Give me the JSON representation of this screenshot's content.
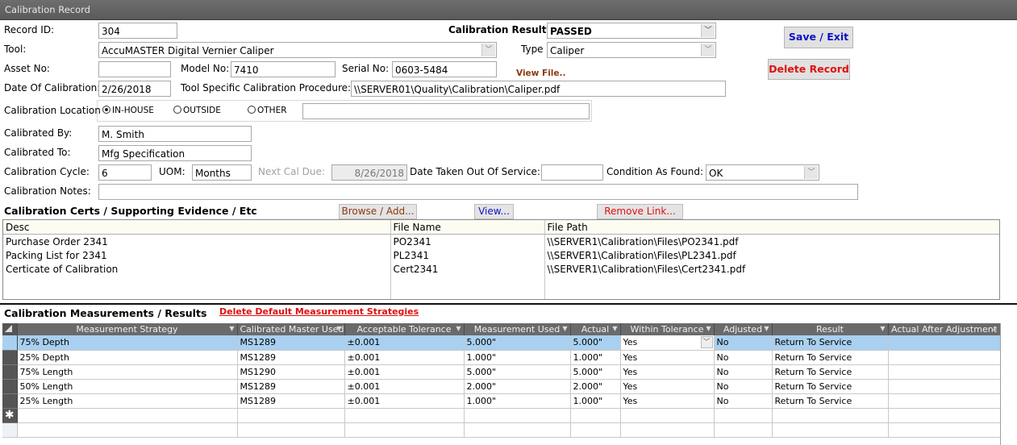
{
  "window": {
    "title": "Calibration Record"
  },
  "record": {
    "record_id_label": "Record ID:",
    "record_id": "304",
    "tool_label": "Tool:",
    "tool": "AccuMASTER Digital Vernier Caliper",
    "asset_label": "Asset No:",
    "asset": "",
    "model_label": "Model No:",
    "model": "7410",
    "serial_label": "Serial No:",
    "serial": "0603-5484",
    "date_label": "Date Of Calibration:",
    "date": "2/26/2018",
    "procedure_label": "Tool Specific Calibration Procedure:",
    "procedure": "\\\\SERVER01\\Quality\\Calibration\\Caliper.pdf",
    "result_label": "Calibration Result:",
    "result": "PASSED",
    "type_label": "Type",
    "type": "Caliper",
    "view_file": "View File.."
  },
  "actions": {
    "save_exit": "Save / Exit",
    "delete_record": "Delete Record"
  },
  "location": {
    "label": "Calibration Location",
    "options": [
      {
        "label": "IN-HOUSE",
        "selected": true
      },
      {
        "label": "OUTSIDE",
        "selected": false
      },
      {
        "label": "OTHER",
        "selected": false
      }
    ],
    "other_value": ""
  },
  "details": {
    "cal_by_label": "Calibrated By:",
    "cal_by": "M. Smith",
    "cal_to_label": "Calibrated To:",
    "cal_to": "Mfg Specification",
    "cycle_label": "Calibration Cycle:",
    "cycle": "6",
    "uom_label": "UOM:",
    "uom": "Months",
    "next_due_label": "Next Cal Due:",
    "next_due": "8/26/2018",
    "out_of_service_label": "Date Taken Out Of Service:",
    "out_of_service": "",
    "condition_label": "Condition As Found:",
    "condition": "OK",
    "notes_label": "Calibration Notes:",
    "notes": ""
  },
  "certs": {
    "title": "Calibration Certs / Supporting Evidence / Etc",
    "browse": "Browse / Add...",
    "view": "View...",
    "remove": "Remove Link...",
    "columns": [
      "Desc",
      "File Name",
      "File Path"
    ],
    "rows": [
      [
        "Purchase Order 2341",
        "PO2341",
        "\\\\SERVER1\\Calibration\\Files\\PO2341.pdf"
      ],
      [
        "Packing List for 2341",
        "PL2341",
        "\\\\SERVER1\\Calibration\\Files\\PL2341.pdf"
      ],
      [
        "Certicate of Calibration",
        "Cert2341",
        "\\\\SERVER1\\Calibration\\Files\\Cert2341.pdf"
      ]
    ]
  },
  "measurements": {
    "title": "Calibration Measurements / Results",
    "delete_defaults": "Delete Default Measurement Strategies",
    "columns": [
      "Measurement Strategy",
      "Calibrated Master Used",
      "Acceptable Tolerance",
      "Measurement Used",
      "Actual",
      "Within Tolerance",
      "Adjusted",
      "Result",
      "Actual After Adjustment"
    ],
    "rows": [
      [
        "75% Depth",
        "MS1289",
        "±0.001",
        "5.000\"",
        "5.000\"",
        "Yes",
        "No",
        "Return To Service",
        ""
      ],
      [
        "25% Depth",
        "MS1289",
        "±0.001",
        "1.000\"",
        "1.000\"",
        "Yes",
        "No",
        "Return To Service",
        ""
      ],
      [
        "75% Length",
        "MS1290",
        "±0.001",
        "5.000\"",
        "5.000\"",
        "Yes",
        "No",
        "Return To Service",
        ""
      ],
      [
        "50% Length",
        "MS1289",
        "±0.001",
        "2.000\"",
        "2.000\"",
        "Yes",
        "No",
        "Return To Service",
        ""
      ],
      [
        "25% Length",
        "MS1289",
        "±0.001",
        "1.000\"",
        "1.000\"",
        "Yes",
        "No",
        "Return To Service",
        ""
      ]
    ],
    "new_row_marker": "✱"
  },
  "colors": {
    "accent_blue": "#1010c8",
    "danger_red": "#e01010",
    "link_brown": "#8b3a0f",
    "selected_row": "#a9d0f0"
  }
}
